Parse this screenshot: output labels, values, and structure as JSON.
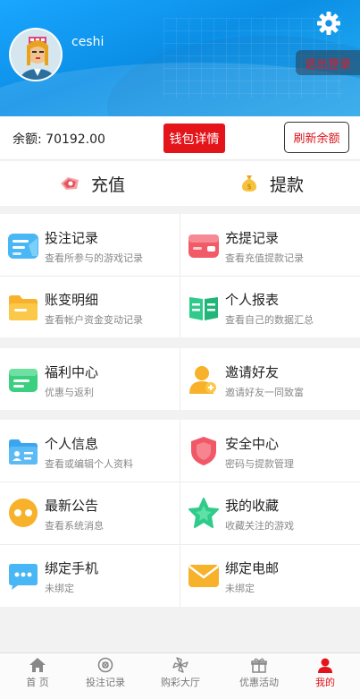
{
  "header": {
    "username": "ceshi",
    "logout_label": "退出登录"
  },
  "balance": {
    "text": "余额: 70192.00",
    "wallet_label": "钱包详情",
    "refresh_label": "刷新余额"
  },
  "actions": {
    "recharge": "充值",
    "withdraw": "提款"
  },
  "menu": {
    "bet_records": {
      "title": "投注记录",
      "sub": "查看所参与的游戏记录"
    },
    "fund_records": {
      "title": "充提记录",
      "sub": "查看充值提款记录"
    },
    "account_changes": {
      "title": "账变明细",
      "sub": "查看帐户资金变动记录"
    },
    "personal_report": {
      "title": "个人报表",
      "sub": "查看自己的数据汇总"
    },
    "welfare": {
      "title": "福利中心",
      "sub": "优惠与返利"
    },
    "invite": {
      "title": "邀请好友",
      "sub": "邀请好友一同致富"
    },
    "profile": {
      "title": "个人信息",
      "sub": "查看或编辑个人资料"
    },
    "security": {
      "title": "安全中心",
      "sub": "密码与提款管理"
    },
    "notice": {
      "title": "最新公告",
      "sub": "查看系统消息"
    },
    "favorites": {
      "title": "我的收藏",
      "sub": "收藏关注的游戏"
    },
    "bind_phone": {
      "title": "绑定手机",
      "sub": "未绑定"
    },
    "bind_email": {
      "title": "绑定电邮",
      "sub": "未绑定"
    }
  },
  "tabbar": {
    "home": "首 页",
    "bets": "投注记录",
    "lottery": "购彩大厅",
    "promo": "优惠活动",
    "mine": "我的"
  },
  "colors": {
    "primary_red": "#e4141b",
    "header_blue": "#1aa6ff"
  }
}
